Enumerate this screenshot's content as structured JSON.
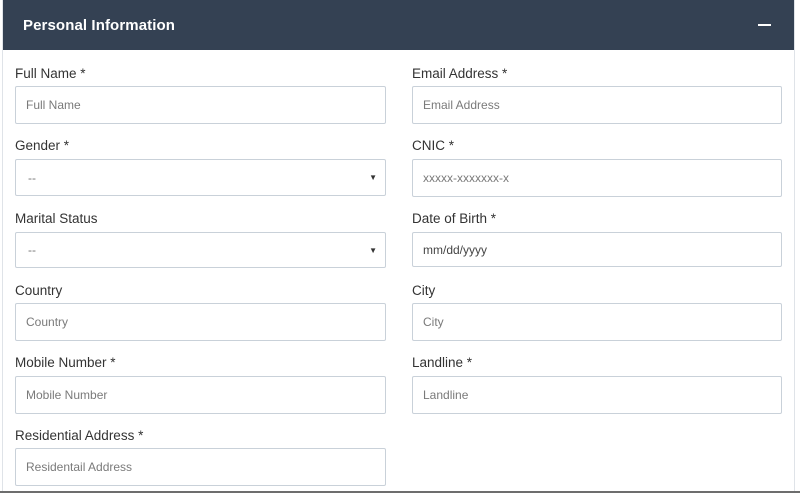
{
  "panel": {
    "title": "Personal Information",
    "collapse_icon": "minus-icon"
  },
  "fields": {
    "full_name": {
      "label": "Full Name *",
      "placeholder": "Full Name"
    },
    "email": {
      "label": "Email Address *",
      "placeholder": "Email Address"
    },
    "gender": {
      "label": "Gender *",
      "value": "--"
    },
    "cnic": {
      "label": "CNIC *",
      "placeholder": "xxxxx-xxxxxxx-x"
    },
    "marital_status": {
      "label": "Marital Status",
      "value": "--"
    },
    "dob": {
      "label": "Date of Birth *",
      "value": "mm/dd/yyyy"
    },
    "country": {
      "label": "Country",
      "placeholder": "Country"
    },
    "city": {
      "label": "City",
      "placeholder": "City"
    },
    "mobile": {
      "label": "Mobile Number *",
      "placeholder": "Mobile Number"
    },
    "landline": {
      "label": "Landline *",
      "placeholder": "Landline"
    },
    "address": {
      "label": "Residential Address *",
      "placeholder": "Residentail Address"
    }
  },
  "colors": {
    "header_bg": "#344153",
    "border": "#c9d1d9"
  }
}
